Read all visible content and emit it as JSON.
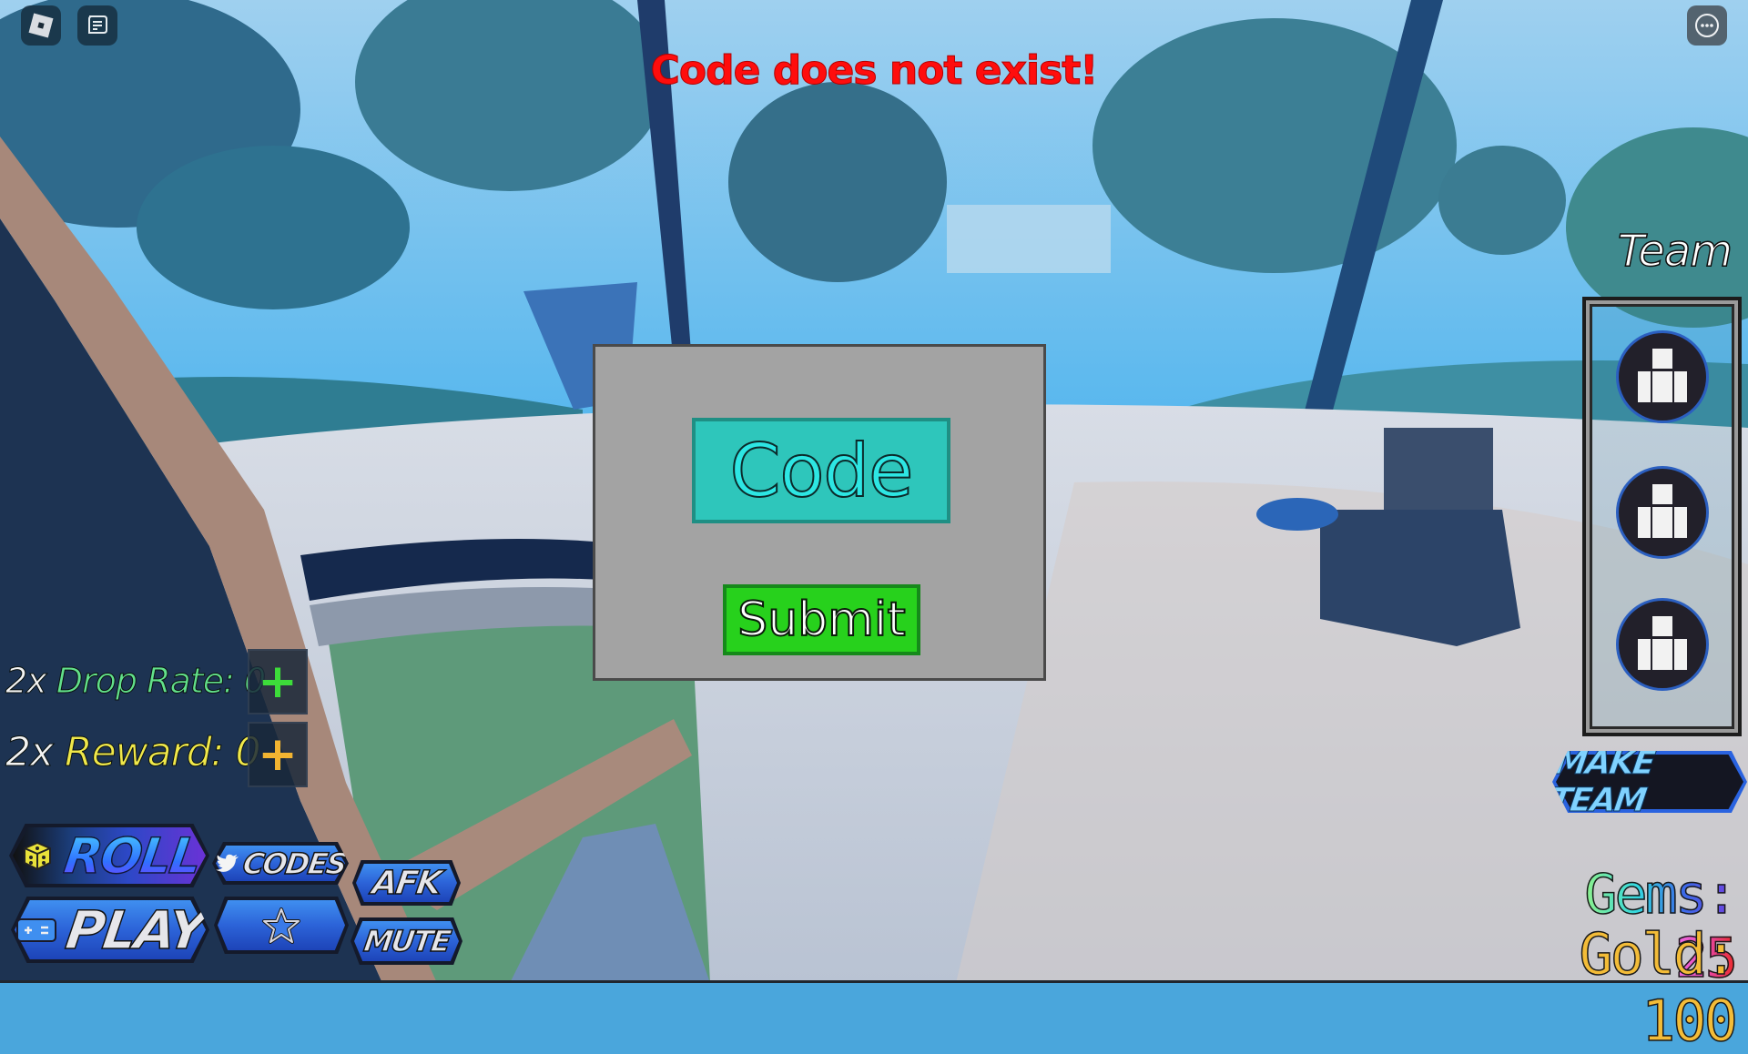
{
  "topbar": {
    "roblox_icon": "roblox-logo-icon",
    "chat_icon": "chat-icon",
    "menu_icon": "more-options-icon"
  },
  "notification": {
    "message": "Code does not exist!",
    "color": "#ff0d0d"
  },
  "code_dialog": {
    "input_placeholder": "Code",
    "input_value": "",
    "submit_label": "Submit",
    "colors": {
      "panel": "#a3a3a3",
      "input": "#2ec6bb",
      "submit": "#27d11c"
    }
  },
  "boosts": [
    {
      "prefix": "2x",
      "label": "Drop Rate:",
      "value": "0",
      "add_icon": "plus-icon",
      "color": "#62e18b",
      "plus_color": "#3ddc3a"
    },
    {
      "prefix": "2x",
      "label": "Reward:",
      "value": "0",
      "add_icon": "plus-icon",
      "color": "#f0e84a",
      "plus_color": "#f2b431"
    }
  ],
  "menu_buttons": {
    "roll": {
      "label": "ROLL",
      "icon": "dice-icon"
    },
    "play": {
      "label": "PLAY",
      "icon": "gamepad-icon"
    },
    "codes": {
      "label": "CODES",
      "icon": "twitter-bird-icon"
    },
    "favorite": {
      "label": "",
      "icon": "star-icon"
    },
    "afk": {
      "label": "AFK"
    },
    "mute": {
      "label": "MUTE"
    }
  },
  "team": {
    "title": "Team",
    "slots": [
      {
        "icon": "empty-character-slot-icon"
      },
      {
        "icon": "empty-character-slot-icon"
      },
      {
        "icon": "empty-character-slot-icon"
      }
    ],
    "make_team_label": "MAKE TEAM"
  },
  "currency": {
    "gems_label": "Gems:",
    "gems_value": "25",
    "gold_label": "Gold:",
    "gold_value": "100"
  }
}
